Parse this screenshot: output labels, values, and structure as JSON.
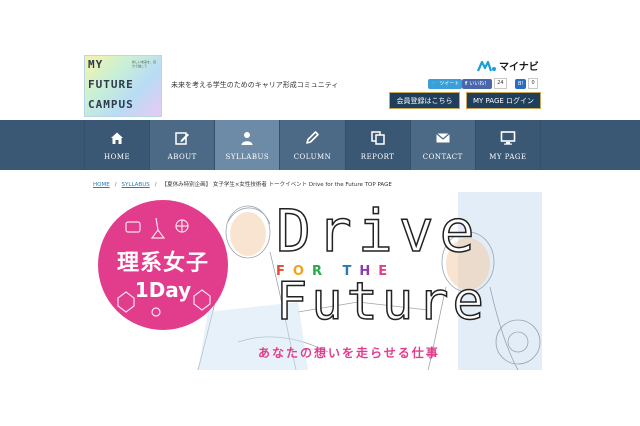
{
  "header": {
    "logo_rows": [
      "MY",
      "FUTURE",
      "CAMPUS"
    ],
    "logo_sub": "新しい未来を、自分で描こう",
    "tagline": "未来を考える学生のためのキャリア形成コミュニティ",
    "brand_name": "マイナビ",
    "social": {
      "tweet_label": "ツイート",
      "like_label": "いいね！",
      "like_count": "24",
      "hatena_label": "B!",
      "hatena_count": "0"
    },
    "register_label": "会員登録はこちら",
    "mypage_login_label": "MY PAGE ログイン"
  },
  "nav": {
    "items": [
      {
        "label": "HOME",
        "icon": "home-icon"
      },
      {
        "label": "ABOUT",
        "icon": "pencil-note-icon"
      },
      {
        "label": "SYLLABUS",
        "icon": "person-icon"
      },
      {
        "label": "COLUMN",
        "icon": "pen-icon"
      },
      {
        "label": "REPORT",
        "icon": "copy-icon"
      },
      {
        "label": "CONTACT",
        "icon": "mail-icon"
      },
      {
        "label": "MY PAGE",
        "icon": "monitor-icon"
      }
    ],
    "active": "SYLLABUS"
  },
  "breadcrumb": {
    "home": "HOME",
    "syllabus": "SYLLABUS",
    "current": "【夏休み特別企画】 女子学生×女性技術者 トークイベント Drive for the Future TOP PAGE"
  },
  "hero": {
    "badge_line1": "理系女子",
    "badge_line2": "1Day",
    "title_drive": "Drive",
    "title_forthe": "FOR THE",
    "title_future": "Future",
    "catchphrase": "あなたの想いを走らせる仕事",
    "colors": {
      "pink": "#e23d8c",
      "forthe": [
        "#e8462d",
        "#f2a11f",
        "#2aa84a",
        "#2b7ab0",
        "#8c3cb0",
        "#e23d8c",
        "#f2a11f"
      ]
    }
  },
  "colors": {
    "nav_bg": "#3a5873",
    "nav_active": "#6d8aa6",
    "header_button": "#1f3f5c",
    "link": "#2b7ab0"
  }
}
